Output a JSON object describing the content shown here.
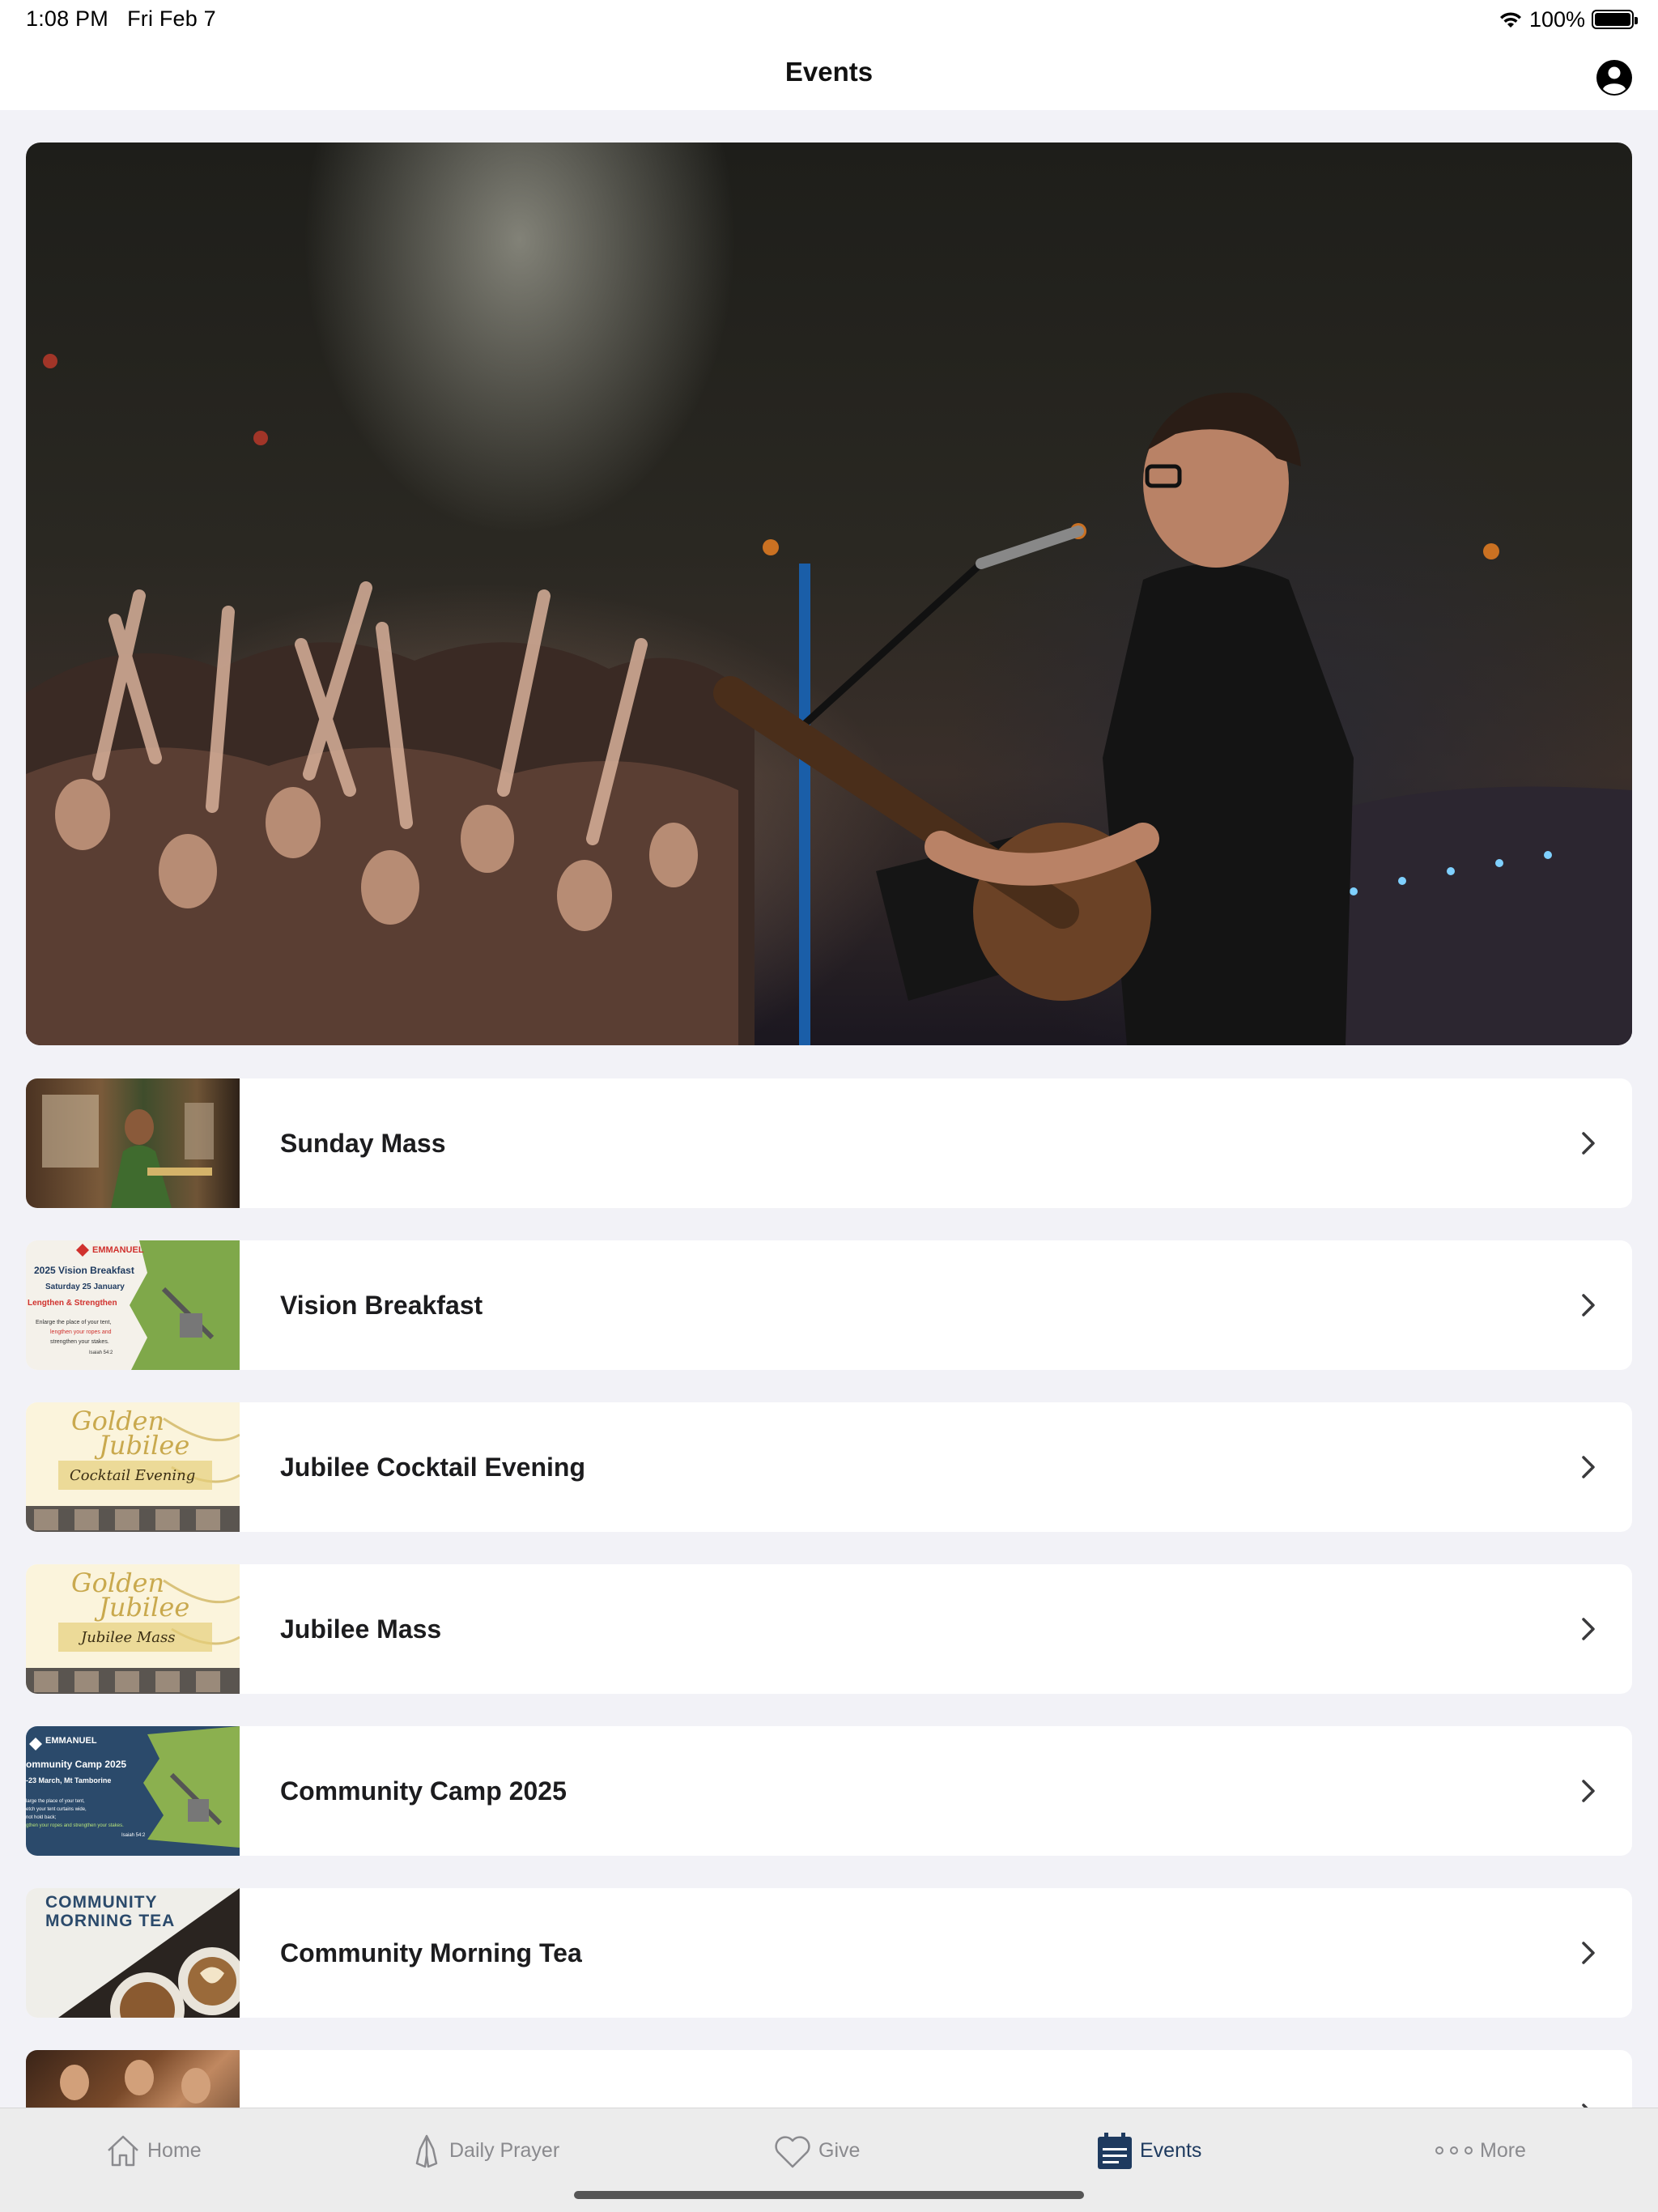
{
  "status_bar": {
    "time": "1:08 PM",
    "date": "Fri Feb 7",
    "battery": "100%"
  },
  "nav": {
    "title": "Events",
    "profile_icon": "person-circle-icon"
  },
  "hero": {
    "description_icon": "concert-photo"
  },
  "events": [
    {
      "title": "Sunday Mass",
      "thumb_icon": "mass-photo"
    },
    {
      "title": "Vision Breakfast",
      "thumb_icon": "vision-breakfast-flyer",
      "thumb_text": {
        "brand": "EMMANUEL",
        "heading": "2025 Vision Breakfast",
        "date": "Saturday 25 January",
        "tagline": "Lengthen & Strengthen",
        "body_1": "Enlarge the place of your tent,",
        "body_2": "lengthen your ropes and",
        "body_3": "strengthen your stakes.",
        "ref": "Isaiah 54:2"
      }
    },
    {
      "title": "Jubilee Cocktail Evening",
      "thumb_icon": "golden-jubilee-flyer",
      "thumb_text": {
        "line1": "Golden",
        "line2": "Jubilee",
        "sub": "Cocktail Evening"
      }
    },
    {
      "title": "Jubilee Mass",
      "thumb_icon": "golden-jubilee-flyer",
      "thumb_text": {
        "line1": "Golden",
        "line2": "Jubilee",
        "sub": "Jubilee Mass"
      }
    },
    {
      "title": "Community Camp 2025",
      "thumb_icon": "community-camp-flyer",
      "thumb_text": {
        "brand": "EMMANUEL",
        "heading": "ommunity Camp 2025",
        "date": "-23 March, Mt Tamborine",
        "body_1": "large the place of your tent,",
        "body_2": "etch your tent curtains wide,",
        "body_3": "not hold back;",
        "body_4": "gthen your ropes and strengthen your stakes.",
        "ref": "Isaiah 54:2"
      }
    },
    {
      "title": "Community Morning Tea",
      "thumb_icon": "coffee-cups-flyer",
      "thumb_text": {
        "line1": "COMMUNITY",
        "line2": "MORNING TEA"
      }
    },
    {
      "title": "",
      "thumb_icon": "group-photo"
    }
  ],
  "tabs": [
    {
      "label": "Home",
      "icon": "house-icon"
    },
    {
      "label": "Daily Prayer",
      "icon": "praying-hands-icon"
    },
    {
      "label": "Give",
      "icon": "heart-icon"
    },
    {
      "label": "Events",
      "icon": "calendar-icon"
    },
    {
      "label": "More",
      "icon": "ellipsis-icon"
    }
  ],
  "colors": {
    "background": "#f2f2f7",
    "card": "#ffffff",
    "tab_active": "#1e3a5f",
    "tab_inactive": "#8a8a8e",
    "jubilee_gold": "#c9a94e",
    "camp_navy": "#2b4a6b",
    "emmanuel_red": "#d0312d"
  }
}
